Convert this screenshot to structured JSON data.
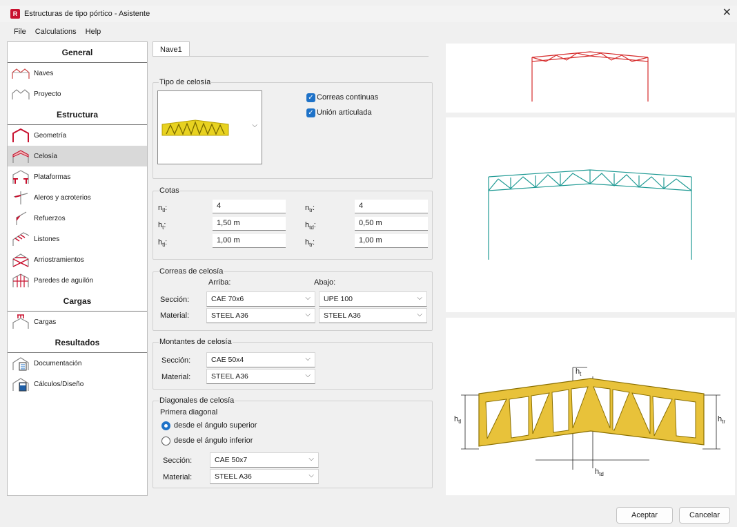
{
  "window": {
    "title": "Estructuras de tipo pórtico - Asistente",
    "app_icon_letter": "R",
    "close_glyph": "✕"
  },
  "menu": [
    "File",
    "Calculations",
    "Help"
  ],
  "sidebar": {
    "sections": [
      {
        "header": "General",
        "items": [
          "Naves",
          "Proyecto"
        ]
      },
      {
        "header": "Estructura",
        "items": [
          "Geometría",
          "Celosía",
          "Plataformas",
          "Aleros y acroterios",
          "Refuerzos",
          "Listones",
          "Arriostramientos",
          "Paredes de aguilón"
        ]
      },
      {
        "header": "Cargas",
        "items": [
          "Cargas"
        ]
      },
      {
        "header": "Resultados",
        "items": [
          "Documentación",
          "Cálculos/Diseño"
        ]
      }
    ],
    "active_item": "Celosía"
  },
  "tab": "Nave1",
  "tipo_celosia": {
    "title": "Tipo de celosía",
    "correas_continuas": "Correas continuas",
    "union_articulada": "Unión articulada"
  },
  "cotas": {
    "title": "Cotas",
    "ntl": {
      "label": "n",
      "sub": "tl",
      "value": "4"
    },
    "ntr": {
      "label": "n",
      "sub": "tr",
      "value": "4"
    },
    "ht": {
      "label": "h",
      "sub": "t",
      "value": "1,50 m"
    },
    "htd": {
      "label": "h",
      "sub": "td",
      "value": "0,50 m"
    },
    "htl": {
      "label": "h",
      "sub": "tl",
      "value": "1,00 m"
    },
    "htr": {
      "label": "h",
      "sub": "tr",
      "value": "1,00 m"
    }
  },
  "correas": {
    "title": "Correas de celosía",
    "arriba": "Arriba:",
    "abajo": "Abajo:",
    "seccion_label": "Sección:",
    "material_label": "Material:",
    "seccion_arriba": "CAE 70x6",
    "seccion_abajo": "UPE 100",
    "material_arriba": "STEEL A36",
    "material_abajo": "STEEL A36"
  },
  "montantes": {
    "title": "Montantes de celosía",
    "seccion_label": "Sección:",
    "material_label": "Material:",
    "seccion": "CAE 50x4",
    "material": "STEEL A36"
  },
  "diagonales": {
    "title": "Diagonales de celosía",
    "primera": "Primera diagonal",
    "opt_superior": "desde el ángulo superior",
    "opt_inferior": "desde el ángulo inferior",
    "seccion_label": "Sección:",
    "material_label": "Material:",
    "seccion": "CAE 50x7",
    "material": "STEEL A36"
  },
  "diagram_labels": {
    "ht": "h",
    "ht_sub": "t",
    "htl": "h",
    "htl_sub": "tl",
    "htr": "h",
    "htr_sub": "tr",
    "htd": "h",
    "htd_sub": "td"
  },
  "buttons": {
    "ok": "Aceptar",
    "cancel": "Cancelar"
  },
  "colors": {
    "accent": "#1e72c8",
    "red": "#d62b2b",
    "teal": "#1f9a94",
    "truss_yellow": "#e8c23a"
  }
}
